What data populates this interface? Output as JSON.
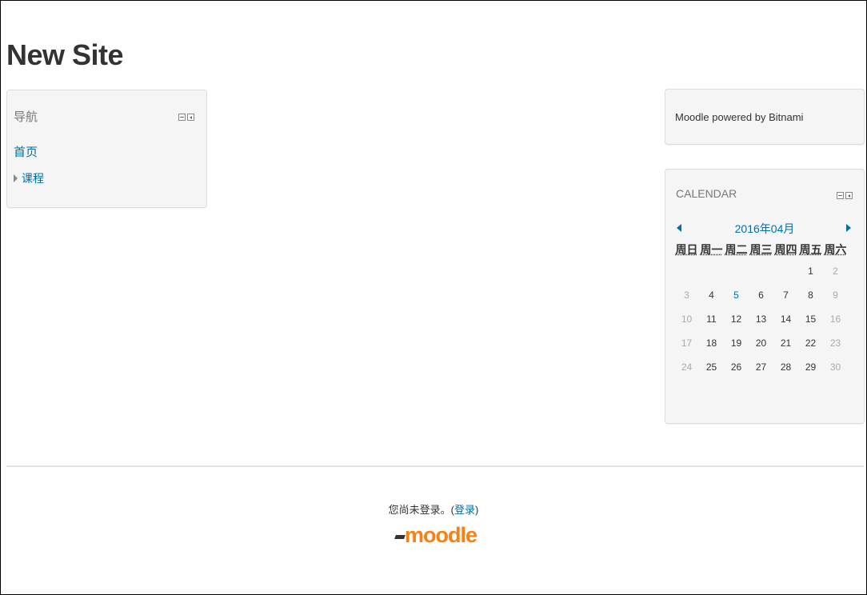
{
  "site": {
    "title": "New Site"
  },
  "navigation": {
    "title": "导航",
    "home": "首页",
    "courses": "课程"
  },
  "about": {
    "text": "Moodle powered by Bitnami"
  },
  "calendar": {
    "title": "CALENDAR",
    "month": "2016年04月",
    "weekdays": [
      "周日",
      "周一",
      "周二",
      "周三",
      "周四",
      "周五",
      "周六"
    ],
    "days": [
      "",
      "",
      "",
      "",
      "",
      "1",
      "2",
      "3",
      "4",
      "5",
      "6",
      "7",
      "8",
      "9",
      "10",
      "11",
      "12",
      "13",
      "14",
      "15",
      "16",
      "17",
      "18",
      "19",
      "20",
      "21",
      "22",
      "23",
      "24",
      "25",
      "26",
      "27",
      "28",
      "29",
      "30"
    ],
    "event_day": "5"
  },
  "footer": {
    "login_prefix": "您尚未登录。(",
    "login_link": "登录",
    "login_suffix": ")",
    "logo": "moodle"
  },
  "colors": {
    "link": "#0070a8",
    "logo": "#f98012"
  }
}
